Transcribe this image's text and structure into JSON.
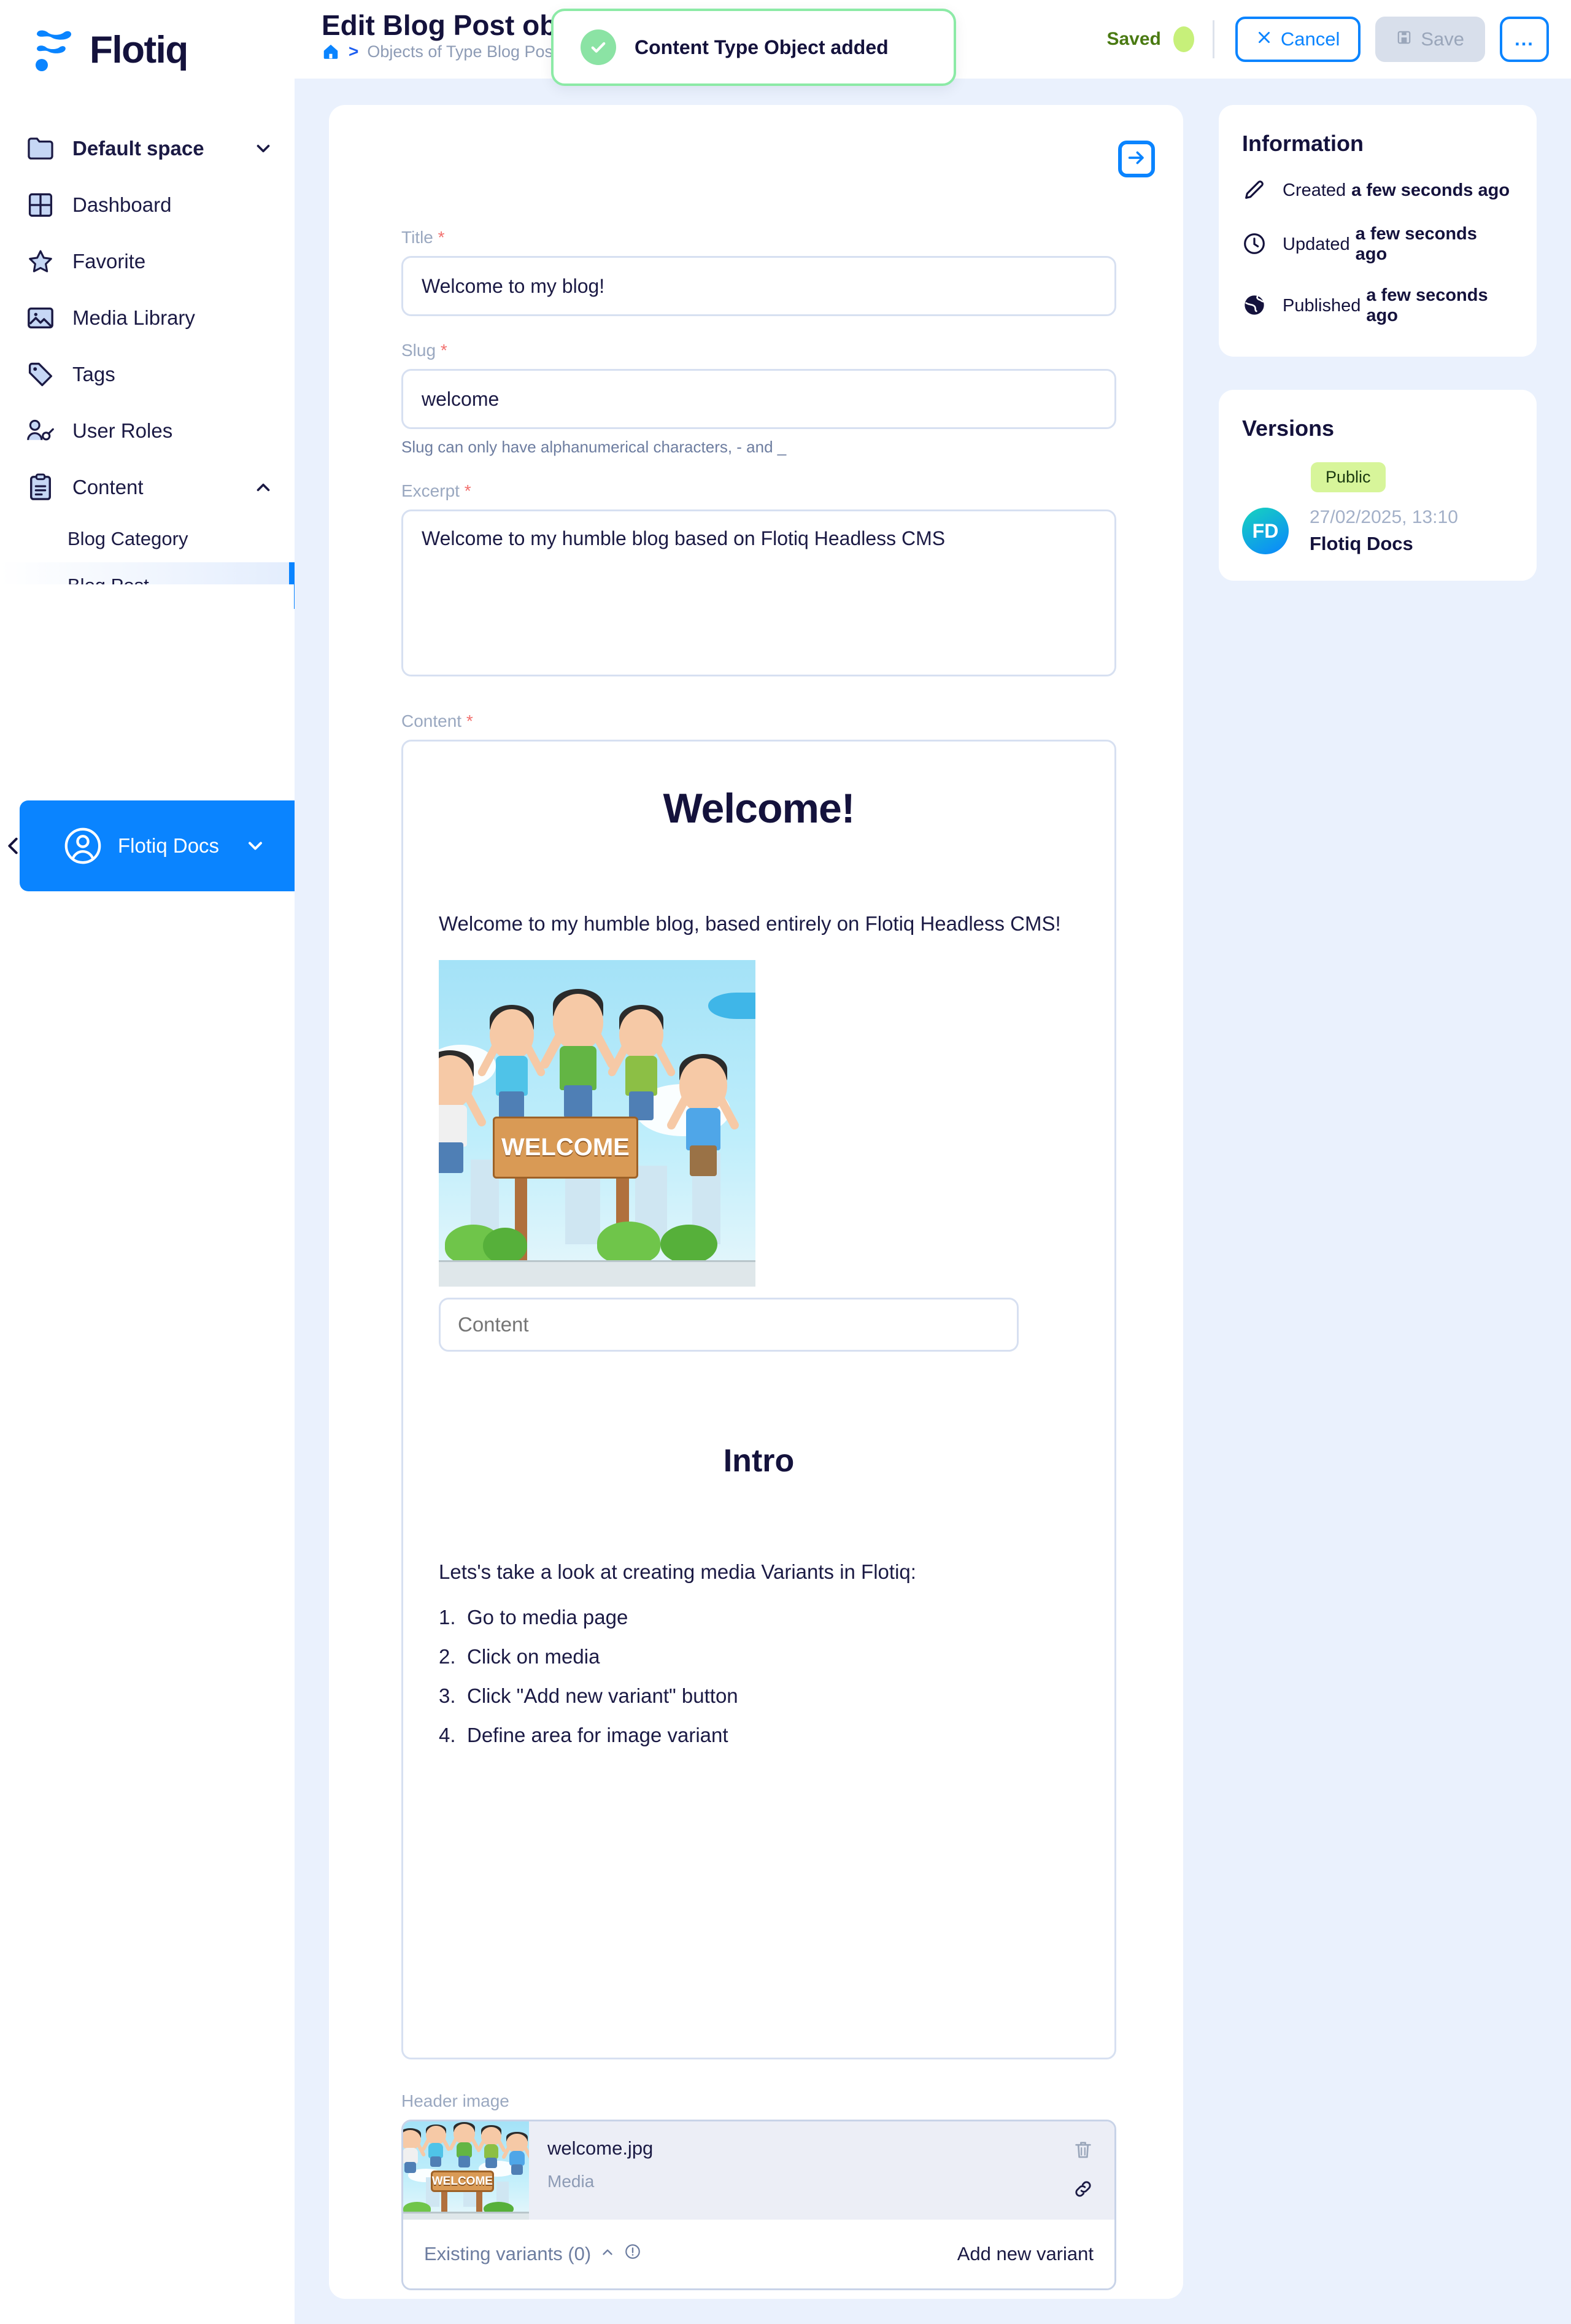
{
  "brand": {
    "name": "Flotiq"
  },
  "sidebar": {
    "space": {
      "label": "Default space",
      "icon": "folder-icon",
      "chevron": "chevron-down-icon"
    },
    "items": [
      {
        "label": "Dashboard",
        "icon": "grid-icon"
      },
      {
        "label": "Favorite",
        "icon": "star-icon"
      },
      {
        "label": "Media Library",
        "icon": "image-icon"
      },
      {
        "label": "Tags",
        "icon": "tag-icon"
      },
      {
        "label": "User Roles",
        "icon": "users-key-icon"
      },
      {
        "label": "Content",
        "icon": "clipboard-icon",
        "chevron": "chevron-up-icon",
        "expanded": true
      }
    ],
    "content_children": [
      {
        "label": "Blog Category",
        "active": false
      },
      {
        "label": "Blog Post",
        "active": true
      }
    ],
    "user": {
      "name": "Flotiq Docs",
      "avatar_icon": "user-circle-icon",
      "chevron": "chevron-down-icon",
      "collapse_icon": "chevron-left-icon"
    }
  },
  "header": {
    "title": "Edit Blog Post object",
    "breadcrumb": [
      {
        "label": "",
        "icon": "home-icon"
      },
      {
        "label": "Objects of Type Blog Post"
      },
      {
        "label": "E"
      }
    ],
    "status": {
      "label": "Saved",
      "dot_color": "#c7f07a",
      "text_color": "#4a7a12"
    },
    "cancel_label": "Cancel",
    "cancel_icon": "close-icon",
    "save_label": "Save",
    "save_icon": "floppy-disk-icon",
    "more_label": "...",
    "expand_icon": "arrow-right-square-icon"
  },
  "toast": {
    "message": "Content Type Object added",
    "icon": "check-circle-icon",
    "border_color": "#8ceaa6"
  },
  "form": {
    "title": {
      "label": "Title",
      "required": true,
      "value": "Welcome to my blog!"
    },
    "slug": {
      "label": "Slug",
      "required": true,
      "value": "welcome",
      "help": "Slug can only have alphanumerical characters, - and _"
    },
    "excerpt": {
      "label": "Excerpt",
      "required": true,
      "value": "Welcome to my humble blog based on Flotiq Headless CMS"
    },
    "content": {
      "label": "Content",
      "required": true,
      "heading": "Welcome!",
      "paragraph": "Welcome to my humble blog, based entirely on Flotiq Headless CMS!",
      "image_alt": "welcome",
      "inline_input_placeholder": "Content",
      "section_heading": "Intro",
      "list_intro": "Lets's take a look at creating media Variants in Flotiq:",
      "list_items": [
        {
          "num": "1.",
          "text": "Go to media page"
        },
        {
          "num": "2.",
          "text": "Click on media"
        },
        {
          "num": "3.",
          "text": "Click \"Add new variant\" button"
        },
        {
          "num": "4.",
          "text": "Define area for image variant"
        }
      ]
    },
    "header_image": {
      "label": "Header image",
      "file_name": "welcome.jpg",
      "file_type": "Media",
      "delete_icon": "trash-icon",
      "link_icon": "link-icon",
      "variants_label": "Existing variants (0)",
      "variants_chevron": "chevron-up-icon",
      "variants_info_icon": "info-icon",
      "add_variant_label": "Add new variant"
    }
  },
  "information": {
    "title": "Information",
    "rows": [
      {
        "icon": "pencil-icon",
        "label": "Created",
        "value": "a few seconds ago"
      },
      {
        "icon": "clock-icon",
        "label": "Updated",
        "value": "a few seconds ago"
      },
      {
        "icon": "globe-icon",
        "label": "Published",
        "value": "a few seconds ago"
      }
    ]
  },
  "versions": {
    "title": "Versions",
    "entries": [
      {
        "badge": "Public",
        "badge_color": "#d7f59a",
        "initials": "FD",
        "date": "27/02/2025, 13:10",
        "author": "Flotiq Docs"
      }
    ]
  }
}
